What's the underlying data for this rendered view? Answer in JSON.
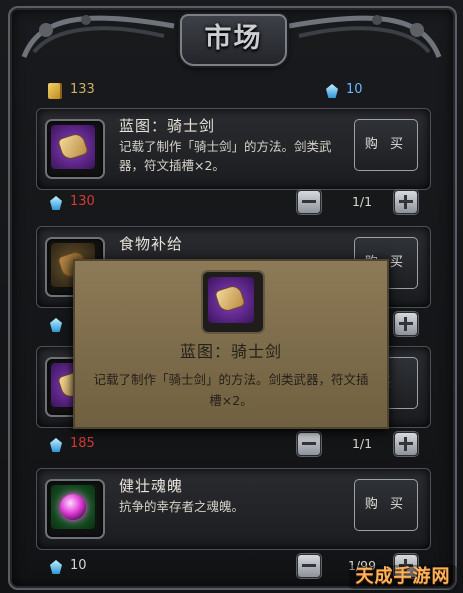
{
  "window": {
    "title": "市场"
  },
  "currency": {
    "gold": "133",
    "gems": "10"
  },
  "items": [
    {
      "name": "蓝图：骑士剑",
      "desc": "记载了制作「骑士剑」的方法。剑类武器，符文插槽×2。",
      "buy_label": "购 买",
      "price": "130",
      "quantity": "1/1"
    },
    {
      "name": "食物补给",
      "desc": "",
      "buy_label": "购 买",
      "price": "",
      "quantity": ""
    },
    {
      "name": "",
      "desc": "",
      "buy_label": "买",
      "price": "185",
      "quantity": "1/1"
    },
    {
      "name": "健壮魂魄",
      "desc": "抗争的幸存者之魂魄。",
      "buy_label": "购 买",
      "price": "10",
      "quantity": "1/99"
    }
  ],
  "tooltip": {
    "name": "蓝图：骑士剑",
    "desc": "记载了制作「骑士剑」的方法。剑类武器，符文插槽×2。"
  },
  "watermark": {
    "text": "天成手游网"
  },
  "colors": {
    "price_red": "#d53a34",
    "gem_blue": "#6fb6ff",
    "tooltip_parchment": "#8d7a57"
  }
}
